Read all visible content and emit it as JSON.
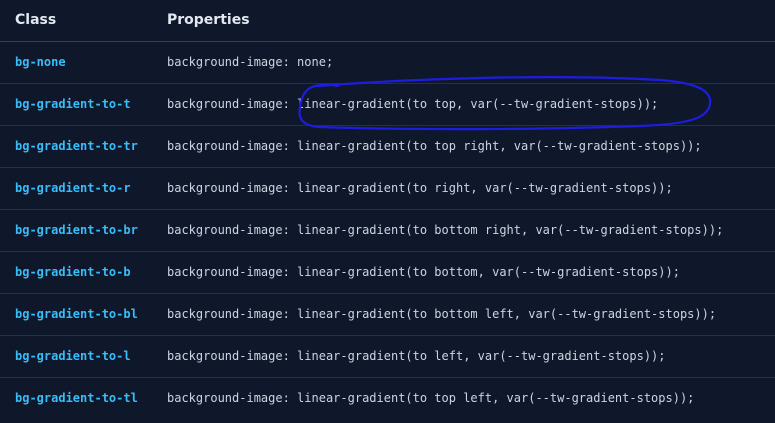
{
  "table": {
    "headers": {
      "class": "Class",
      "properties": "Properties"
    },
    "rows": [
      {
        "class": "bg-none",
        "property": "background-image: none;"
      },
      {
        "class": "bg-gradient-to-t",
        "property": "background-image: linear-gradient(to top, var(--tw-gradient-stops));"
      },
      {
        "class": "bg-gradient-to-tr",
        "property": "background-image: linear-gradient(to top right, var(--tw-gradient-stops));"
      },
      {
        "class": "bg-gradient-to-r",
        "property": "background-image: linear-gradient(to right, var(--tw-gradient-stops));"
      },
      {
        "class": "bg-gradient-to-br",
        "property": "background-image: linear-gradient(to bottom right, var(--tw-gradient-stops));"
      },
      {
        "class": "bg-gradient-to-b",
        "property": "background-image: linear-gradient(to bottom, var(--tw-gradient-stops));"
      },
      {
        "class": "bg-gradient-to-bl",
        "property": "background-image: linear-gradient(to bottom left, var(--tw-gradient-stops));"
      },
      {
        "class": "bg-gradient-to-l",
        "property": "background-image: linear-gradient(to left, var(--tw-gradient-stops));"
      },
      {
        "class": "bg-gradient-to-tl",
        "property": "background-image: linear-gradient(to top left, var(--tw-gradient-stops));"
      }
    ]
  },
  "colors": {
    "background": "#0f172a",
    "class_text": "#38bdf8",
    "property_text": "#cbd5e1",
    "header_text": "#e2e8f0",
    "annotation_ink": "#1d1de0"
  }
}
